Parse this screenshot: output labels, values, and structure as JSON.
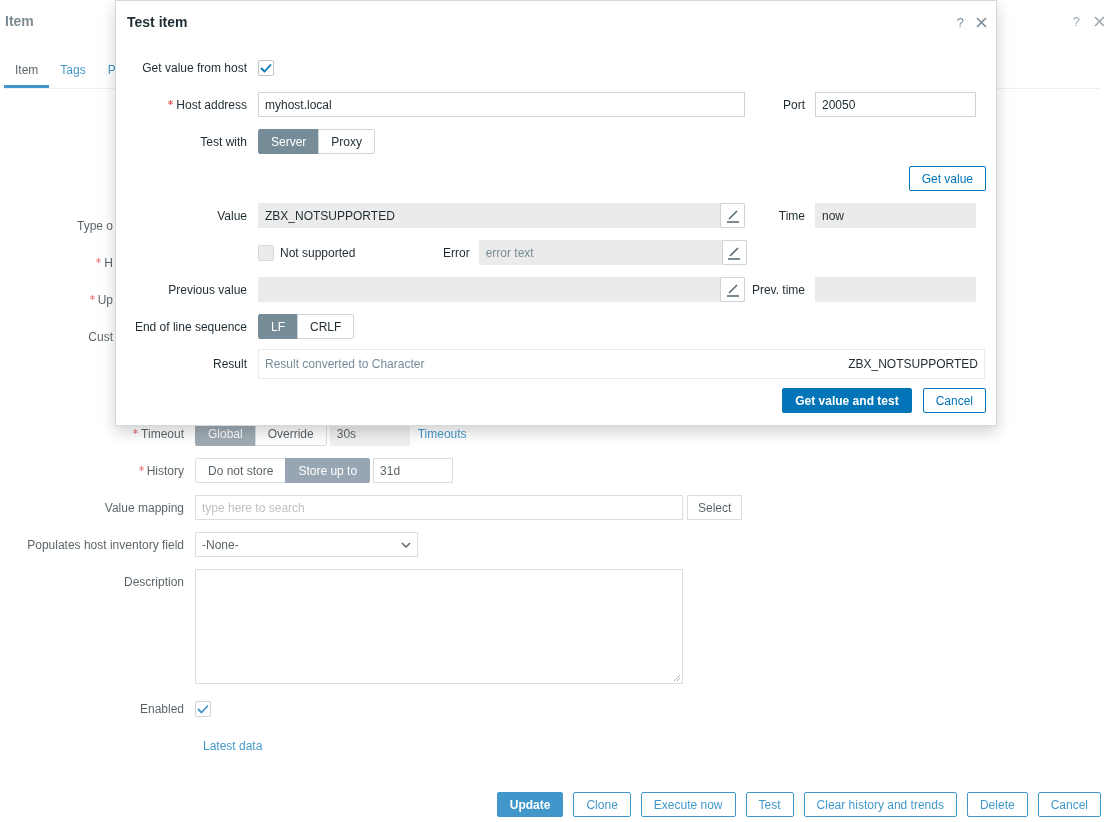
{
  "page": {
    "title": "Item",
    "help": "?",
    "tabs": [
      {
        "label": "Item",
        "selected": true
      },
      {
        "label": "Tags",
        "selected": false
      },
      {
        "label": "P",
        "selected": false
      }
    ],
    "cut_labels": [
      {
        "label": "Type o",
        "required": false
      },
      {
        "label": "H",
        "required": true
      },
      {
        "label": "Up",
        "required": true
      },
      {
        "label": "Cust",
        "required": false
      }
    ],
    "timeout": {
      "label": "Timeout",
      "required": true,
      "options": [
        {
          "label": "Global",
          "selected": true
        },
        {
          "label": "Override",
          "selected": false
        }
      ],
      "value": "30s",
      "link": "Timeouts"
    },
    "history": {
      "label": "History",
      "required": true,
      "options": [
        {
          "label": "Do not store",
          "selected": false
        },
        {
          "label": "Store up to",
          "selected": true
        }
      ],
      "value": "31d"
    },
    "value_mapping": {
      "label": "Value mapping",
      "placeholder": "type here to search",
      "button": "Select"
    },
    "inventory": {
      "label": "Populates host inventory field",
      "value": "-None-"
    },
    "description": {
      "label": "Description"
    },
    "enabled": {
      "label": "Enabled",
      "checked": true
    },
    "latest_data": "Latest data",
    "buttons": [
      {
        "label": "Update",
        "primary": true
      },
      {
        "label": "Clone",
        "primary": false
      },
      {
        "label": "Execute now",
        "primary": false
      },
      {
        "label": "Test",
        "primary": false
      },
      {
        "label": "Clear history and trends",
        "primary": false
      },
      {
        "label": "Delete",
        "primary": false
      },
      {
        "label": "Cancel",
        "primary": false
      }
    ]
  },
  "dialog": {
    "title": "Test item",
    "help": "?",
    "get_value_from_host": {
      "label": "Get value from host",
      "checked": true
    },
    "host_address": {
      "label": "Host address",
      "required": true,
      "value": "myhost.local"
    },
    "port": {
      "label": "Port",
      "value": "20050"
    },
    "test_with": {
      "label": "Test with",
      "options": [
        {
          "label": "Server",
          "selected": true
        },
        {
          "label": "Proxy",
          "selected": false
        }
      ]
    },
    "get_value_button": "Get value",
    "value": {
      "label": "Value",
      "value": "ZBX_NOTSUPPORTED"
    },
    "time": {
      "label": "Time",
      "value": "now"
    },
    "not_supported": {
      "label": "Not supported",
      "checked": false
    },
    "error": {
      "label": "Error",
      "placeholder": "error text"
    },
    "previous_value": {
      "label": "Previous value"
    },
    "prev_time": {
      "label": "Prev. time"
    },
    "eol": {
      "label": "End of line sequence",
      "options": [
        {
          "label": "LF",
          "selected": true
        },
        {
          "label": "CRLF",
          "selected": false
        }
      ]
    },
    "result": {
      "label": "Result",
      "placeholder": "Result converted to Character",
      "value": "ZBX_NOTSUPPORTED"
    },
    "buttons": [
      {
        "label": "Get value and test",
        "primary": true
      },
      {
        "label": "Cancel",
        "primary": false
      }
    ]
  }
}
